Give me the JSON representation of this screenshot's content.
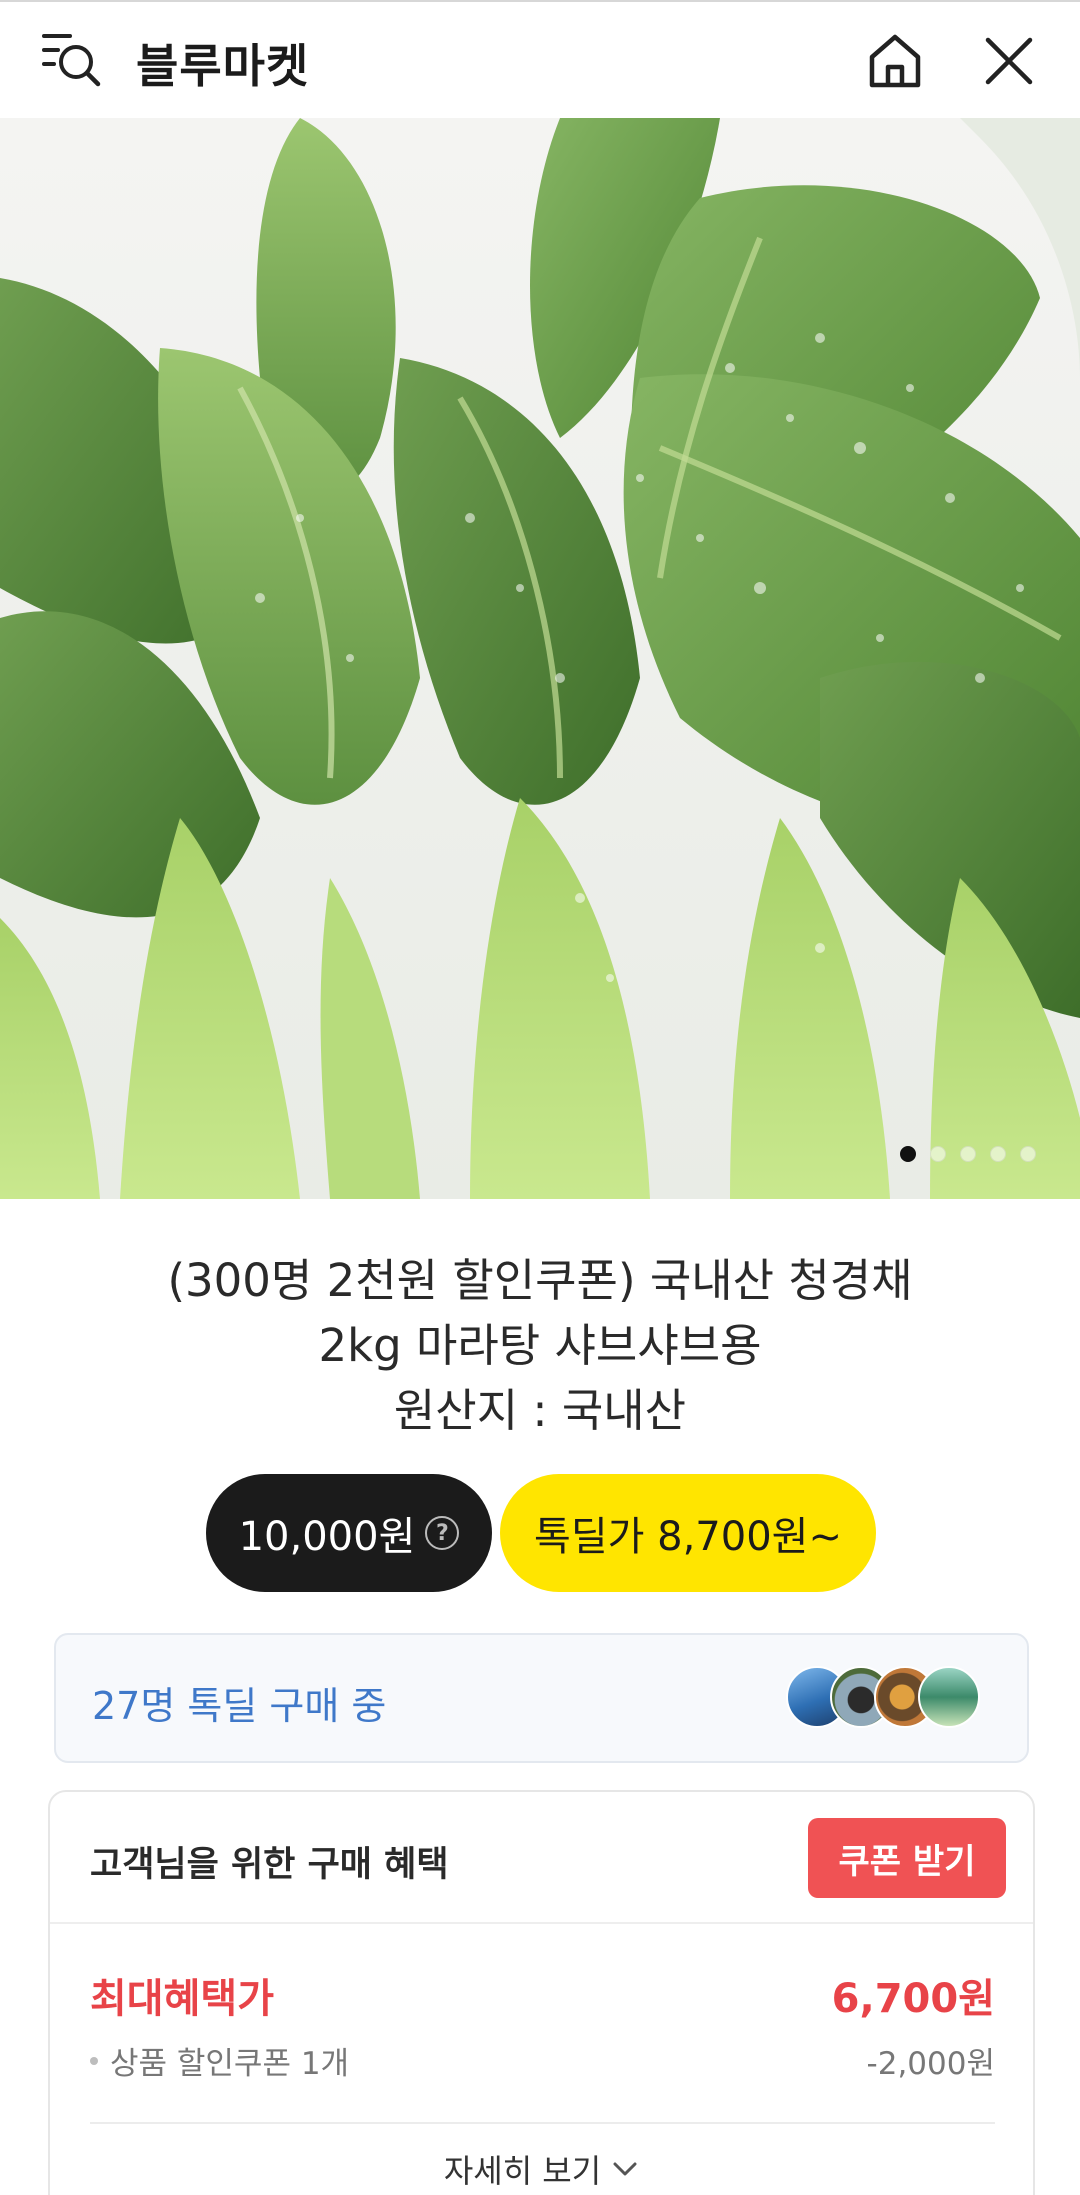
{
  "header": {
    "title": "블루마켓"
  },
  "hero": {
    "slide_count": 5,
    "active_slide": 1
  },
  "product": {
    "title_line1": "(300명 2천원 할인쿠폰) 국내산 청경채",
    "title_line2": "2kg 마라탕 샤브샤브용",
    "title_line3": "원산지 : 국내산",
    "price": "10,000원",
    "price_help": "?",
    "deal_price": "톡딜가 8,700원~"
  },
  "buyers": {
    "text": "27명 톡딜 구매 중"
  },
  "benefits": {
    "title": "고객님을 위한 구매 혜택",
    "coupon_button": "쿠폰 받기",
    "max_label": "최대혜택가",
    "max_value": "6,700원",
    "discount_label": "상품 할인쿠폰 1개",
    "discount_value": "-2,000원",
    "more_link": "자세히 보기"
  },
  "colors": {
    "deal_yellow": "#ffe500",
    "price_black": "#1b1b1b",
    "accent_red": "#f05254",
    "buyers_blue": "#3f78c9"
  }
}
